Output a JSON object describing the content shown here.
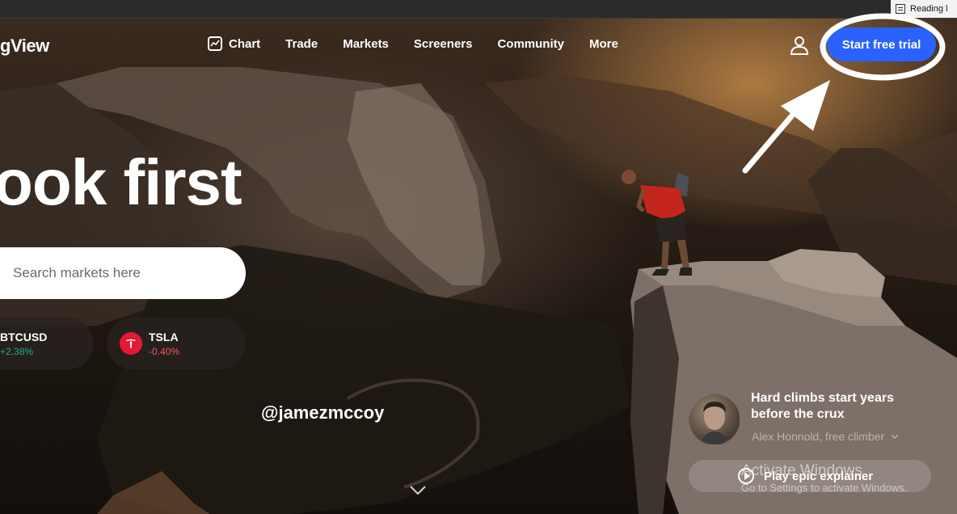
{
  "browser": {
    "reading_list_label": "Reading l"
  },
  "header": {
    "logo_text": "gView",
    "nav": [
      {
        "label": "Chart",
        "icon": "chart-icon"
      },
      {
        "label": "Trade"
      },
      {
        "label": "Markets"
      },
      {
        "label": "Screeners"
      },
      {
        "label": "Community"
      },
      {
        "label": "More"
      }
    ],
    "user_icon": "user-icon",
    "cta_label": "Start free trial",
    "cta_color": "#2962ff"
  },
  "hero": {
    "headline": "ook first",
    "search_placeholder": "Search markets here",
    "tickers": [
      {
        "symbol": "BTCUSD",
        "change": "+2.38%",
        "trend": "up",
        "color": "#22ab94"
      },
      {
        "symbol": "TSLA",
        "change": "-0.40%",
        "trend": "down",
        "color": "#f7525f",
        "icon": "tesla-icon"
      }
    ],
    "photo_credit": "@jamezmccoy",
    "scroll_icon": "chevron-down-icon"
  },
  "quote": {
    "title": "Hard climbs start years before the crux",
    "author": "Alex Honnold, free climber",
    "play_label": "Play epic explainer"
  },
  "os_watermark": {
    "line1": "Activate Windows",
    "line2": "Go to Settings to activate Windows."
  },
  "annotation": {
    "type": "circle-and-arrow",
    "target": "Start free trial",
    "color": "#ffffff"
  }
}
